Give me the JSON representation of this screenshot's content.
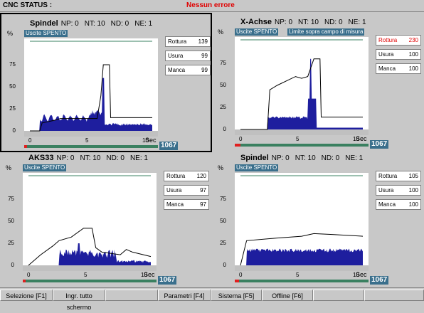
{
  "status": {
    "label": "CNC STATUS :",
    "message": "Nessun errore"
  },
  "axis": {
    "pct": "%",
    "y": [
      "75",
      "50",
      "25",
      "0"
    ],
    "x": [
      "0",
      "5",
      "10"
    ],
    "sec": "Sec"
  },
  "panels": [
    {
      "name": "Spindel",
      "np": "NP: 0",
      "nt": "NT: 10",
      "nd": "ND: 0",
      "ne": "NE: 1",
      "tag": "Uscite SPENTO",
      "tag2": "",
      "stats": [
        {
          "label": "Rottura",
          "value": "139"
        },
        {
          "label": "Usura",
          "value": "99"
        },
        {
          "label": "Manca",
          "value": "99"
        }
      ],
      "count": "1067",
      "progress": 0.02
    },
    {
      "name": "X-Achse",
      "np": "NP: 0",
      "nt": "NT: 10",
      "nd": "ND: 0",
      "ne": "NE: 1",
      "tag": "Uscite SPENTO",
      "tag2": "Limite sopra campo di misura",
      "stats": [
        {
          "label": "Rottura",
          "value": "230"
        },
        {
          "label": "Usura",
          "value": "100"
        },
        {
          "label": "Manca",
          "value": "100"
        }
      ],
      "count": "1067",
      "progress": 0.04
    },
    {
      "name": "AKS33",
      "np": "NP: 0",
      "nt": "NT: 10",
      "nd": "ND: 0",
      "ne": "NE: 1",
      "tag": "Uscite SPENTO",
      "tag2": "",
      "stats": [
        {
          "label": "Rottura",
          "value": "120"
        },
        {
          "label": "Usura",
          "value": "97"
        },
        {
          "label": "Manca",
          "value": "97"
        }
      ],
      "count": "1067",
      "progress": 0.02
    },
    {
      "name": "Spindel",
      "np": "NP: 0",
      "nt": "NT: 10",
      "nd": "ND: 0",
      "ne": "NE: 1",
      "tag": "Uscite SPENTO",
      "tag2": "",
      "stats": [
        {
          "label": "Rottura",
          "value": "105"
        },
        {
          "label": "Usura",
          "value": "100"
        },
        {
          "label": "Manca",
          "value": "100"
        }
      ],
      "count": "1067",
      "progress": 0.03
    }
  ],
  "taskbar": [
    "Selezione [F1]",
    "Ingr. tutto schermo",
    "",
    "Parametri [F4]",
    "Sistema [F5]",
    "Offline [F6]",
    "",
    ""
  ],
  "colors": {
    "signal": "#1e1e9e",
    "limit": "#000000",
    "alarm": "#e00000",
    "accent": "#3a6f8c"
  }
}
